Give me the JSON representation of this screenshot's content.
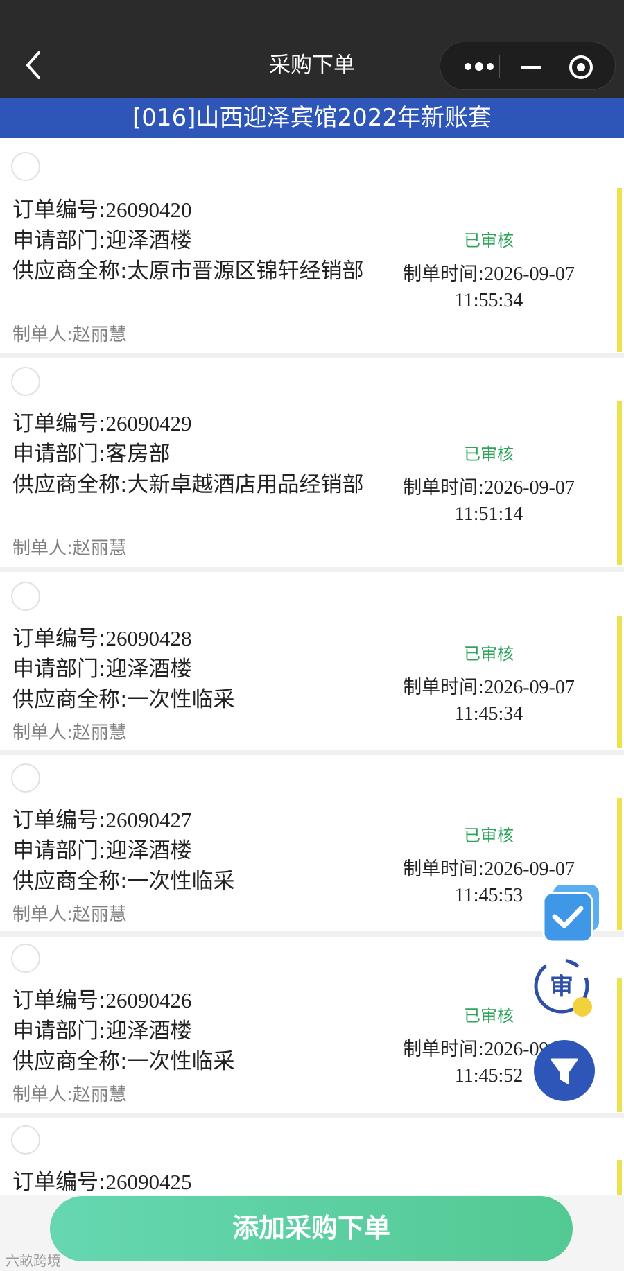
{
  "nav": {
    "title": "采购下单"
  },
  "banner": {
    "text": "[016]山西迎泽宾馆2022年新账套"
  },
  "orders": [
    {
      "order_label": "订单编号:",
      "order_no": "26090420",
      "dept_label": "申请部门:",
      "dept": "迎泽酒楼",
      "supplier_label": "供应商全称:",
      "supplier": "太原市晋源区锦轩经销部",
      "maker_label": "制单人:",
      "maker": "赵丽慧",
      "status": "已审核",
      "time_label": "制单时间:",
      "date": "2026-09-07",
      "time": "11:55:34"
    },
    {
      "order_label": "订单编号:",
      "order_no": "26090429",
      "dept_label": "申请部门:",
      "dept": "客房部",
      "supplier_label": "供应商全称:",
      "supplier": "大新卓越酒店用品经销部",
      "maker_label": "制单人:",
      "maker": "赵丽慧",
      "status": "已审核",
      "time_label": "制单时间:",
      "date": "2026-09-07",
      "time": "11:51:14"
    },
    {
      "order_label": "订单编号:",
      "order_no": "26090428",
      "dept_label": "申请部门:",
      "dept": "迎泽酒楼",
      "supplier_label": "供应商全称:",
      "supplier": "一次性临采",
      "maker_label": "制单人:",
      "maker": "赵丽慧",
      "status": "已审核",
      "time_label": "制单时间:",
      "date": "2026-09-07",
      "time": "11:45:34"
    },
    {
      "order_label": "订单编号:",
      "order_no": "26090427",
      "dept_label": "申请部门:",
      "dept": "迎泽酒楼",
      "supplier_label": "供应商全称:",
      "supplier": "一次性临采",
      "maker_label": "制单人:",
      "maker": "赵丽慧",
      "status": "已审核",
      "time_label": "制单时间:",
      "date": "2026-09-07",
      "time": "11:45:53"
    },
    {
      "order_label": "订单编号:",
      "order_no": "26090426",
      "dept_label": "申请部门:",
      "dept": "迎泽酒楼",
      "supplier_label": "供应商全称:",
      "supplier": "一次性临采",
      "maker_label": "制单人:",
      "maker": "赵丽慧",
      "status": "已审核",
      "time_label": "制单时间:",
      "date": "2026-09-07",
      "time": "11:45:52"
    },
    {
      "order_label": "订单编号:",
      "order_no": "26090425"
    }
  ],
  "fab": {
    "review_label": "审"
  },
  "footer": {
    "add_button": "添加采购下单"
  },
  "watermark": {
    "text": "六畝跨境"
  },
  "icons": {
    "back": "back-arrow-icon",
    "more": "more-dots-icon",
    "minimize": "minimize-icon",
    "close": "close-target-icon",
    "batch_approve": "checkbox-stack-icon",
    "review": "review-stamp-icon",
    "filter": "filter-funnel-icon"
  },
  "colors": {
    "nav_bg": "#2b2b2b",
    "banner_bg": "#2e56b8",
    "status_green": "#2fa55b",
    "accent_yellow": "#ece14e",
    "button_green": "#5cd0a2"
  }
}
